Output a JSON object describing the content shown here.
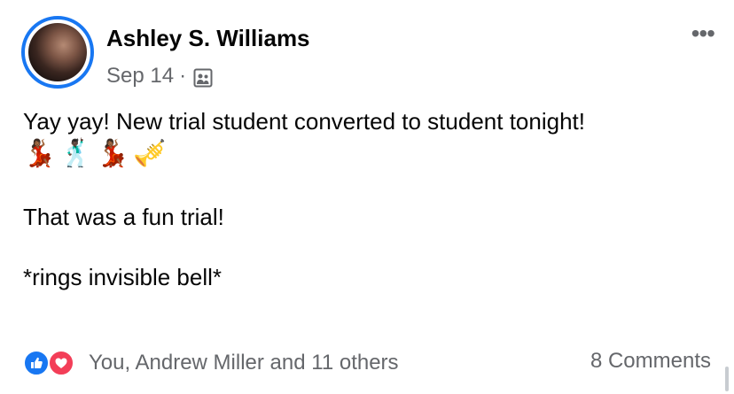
{
  "post": {
    "author": "Ashley S. Williams",
    "date": "Sep 14",
    "separator": "·",
    "audience_icon": "group-icon",
    "more_label": "•••",
    "lines": {
      "l1": "Yay yay! New trial student converted to student tonight!",
      "emojis": [
        "💃🏾",
        "🕺🏿",
        "💃🏾",
        "🎺"
      ],
      "l3": "That was a fun trial!",
      "l5": "*rings invisible bell*"
    }
  },
  "footer": {
    "reactions_text": "You, Andrew Miller and 11 others",
    "comments": "8 Comments",
    "reaction_icons": [
      "like-icon",
      "love-icon"
    ]
  },
  "colors": {
    "accent": "#1877f2",
    "like": "#1877f2",
    "love": "#f33e58",
    "secondary_text": "#65676b"
  }
}
